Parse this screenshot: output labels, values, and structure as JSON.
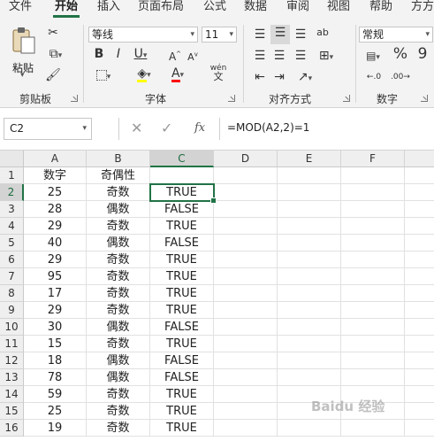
{
  "ribbon_tabs": [
    "文件",
    "开始",
    "插入",
    "页面布局",
    "公式",
    "数据",
    "审阅",
    "视图",
    "帮助",
    "方方"
  ],
  "active_tab": "开始",
  "clipboard": {
    "paste_label": "粘贴",
    "group_label": "剪贴板"
  },
  "font": {
    "name": "等线",
    "size": "11",
    "group_label": "字体",
    "wen_label": "wén",
    "wen_char": "文"
  },
  "alignment": {
    "group_label": "对齐方式",
    "wrap_label": "ab"
  },
  "number": {
    "format": "常规",
    "group_label": "数字",
    "percent": "%",
    "comma": "9"
  },
  "formula_bar": {
    "name_box": "C2",
    "fx_label": "fx",
    "formula": "=MOD(A2,2)=1"
  },
  "grid": {
    "columns": [
      "A",
      "B",
      "C",
      "D",
      "E",
      "F"
    ],
    "rows": [
      [
        "数字",
        "奇偶性",
        ""
      ],
      [
        "25",
        "奇数",
        "TRUE"
      ],
      [
        "28",
        "偶数",
        "FALSE"
      ],
      [
        "29",
        "奇数",
        "TRUE"
      ],
      [
        "40",
        "偶数",
        "FALSE"
      ],
      [
        "29",
        "奇数",
        "TRUE"
      ],
      [
        "95",
        "奇数",
        "TRUE"
      ],
      [
        "17",
        "奇数",
        "TRUE"
      ],
      [
        "29",
        "奇数",
        "TRUE"
      ],
      [
        "30",
        "偶数",
        "FALSE"
      ],
      [
        "15",
        "奇数",
        "TRUE"
      ],
      [
        "18",
        "偶数",
        "FALSE"
      ],
      [
        "78",
        "偶数",
        "FALSE"
      ],
      [
        "59",
        "奇数",
        "TRUE"
      ],
      [
        "25",
        "奇数",
        "TRUE"
      ],
      [
        "19",
        "奇数",
        "TRUE"
      ]
    ],
    "selected_cell": "C2"
  },
  "watermark": "Baidu 经验",
  "colors": {
    "accent": "#217346",
    "highlight": "#ffff00",
    "font_color": "#ff0000"
  }
}
